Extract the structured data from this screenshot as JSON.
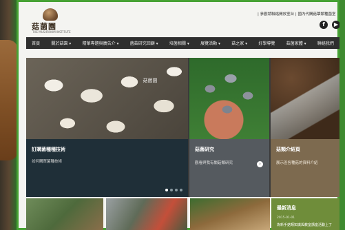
{
  "header": {
    "logo_title": "菇菌園",
    "logo_subtitle": "THE MUSHROOM INSTITUTE",
    "tagline": "| 參觀請聯絡開放室台 | 國內代購菇蕈類種菌室",
    "social": [
      {
        "icon": "facebook-icon",
        "glyph": "f"
      },
      {
        "icon": "youtube-icon",
        "glyph": "▶"
      }
    ]
  },
  "nav": {
    "items": [
      "首頁",
      "關於菇園 ▾",
      "精華專題與廣告介 ▾",
      "菌菇研究回顧 ▾",
      "培菌相關 ▾",
      "展覽活動 ▾",
      "菇之家 ▾",
      "好學導覽",
      "菇菌家體 ▾",
      "聯絡我們"
    ]
  },
  "hero": {
    "watermark": "菇菌園",
    "main": {
      "title": "訂購菌種種技術",
      "desc": "如何購買菌種技術"
    },
    "card2": {
      "title": "菇菌研究",
      "desc": "觀看與我有關菇類研究"
    },
    "card3": {
      "title": "菇類介紹頁",
      "desc": "展示區各種菇的資料介紹"
    },
    "slider_dots": 4,
    "active_dot": 1
  },
  "news": {
    "title": "最新消息",
    "date": "2015-01-01",
    "item": "為新手菇類知識與教室講座活動上了"
  },
  "colors": {
    "frame_border": "#47a234",
    "nav_bg": "#2f2f2f",
    "main_caption_bg": "#1f2f38",
    "card2_bg": "#555a5f",
    "card3_bg": "#7d6a4f",
    "news_bg": "#6f8d3a"
  }
}
